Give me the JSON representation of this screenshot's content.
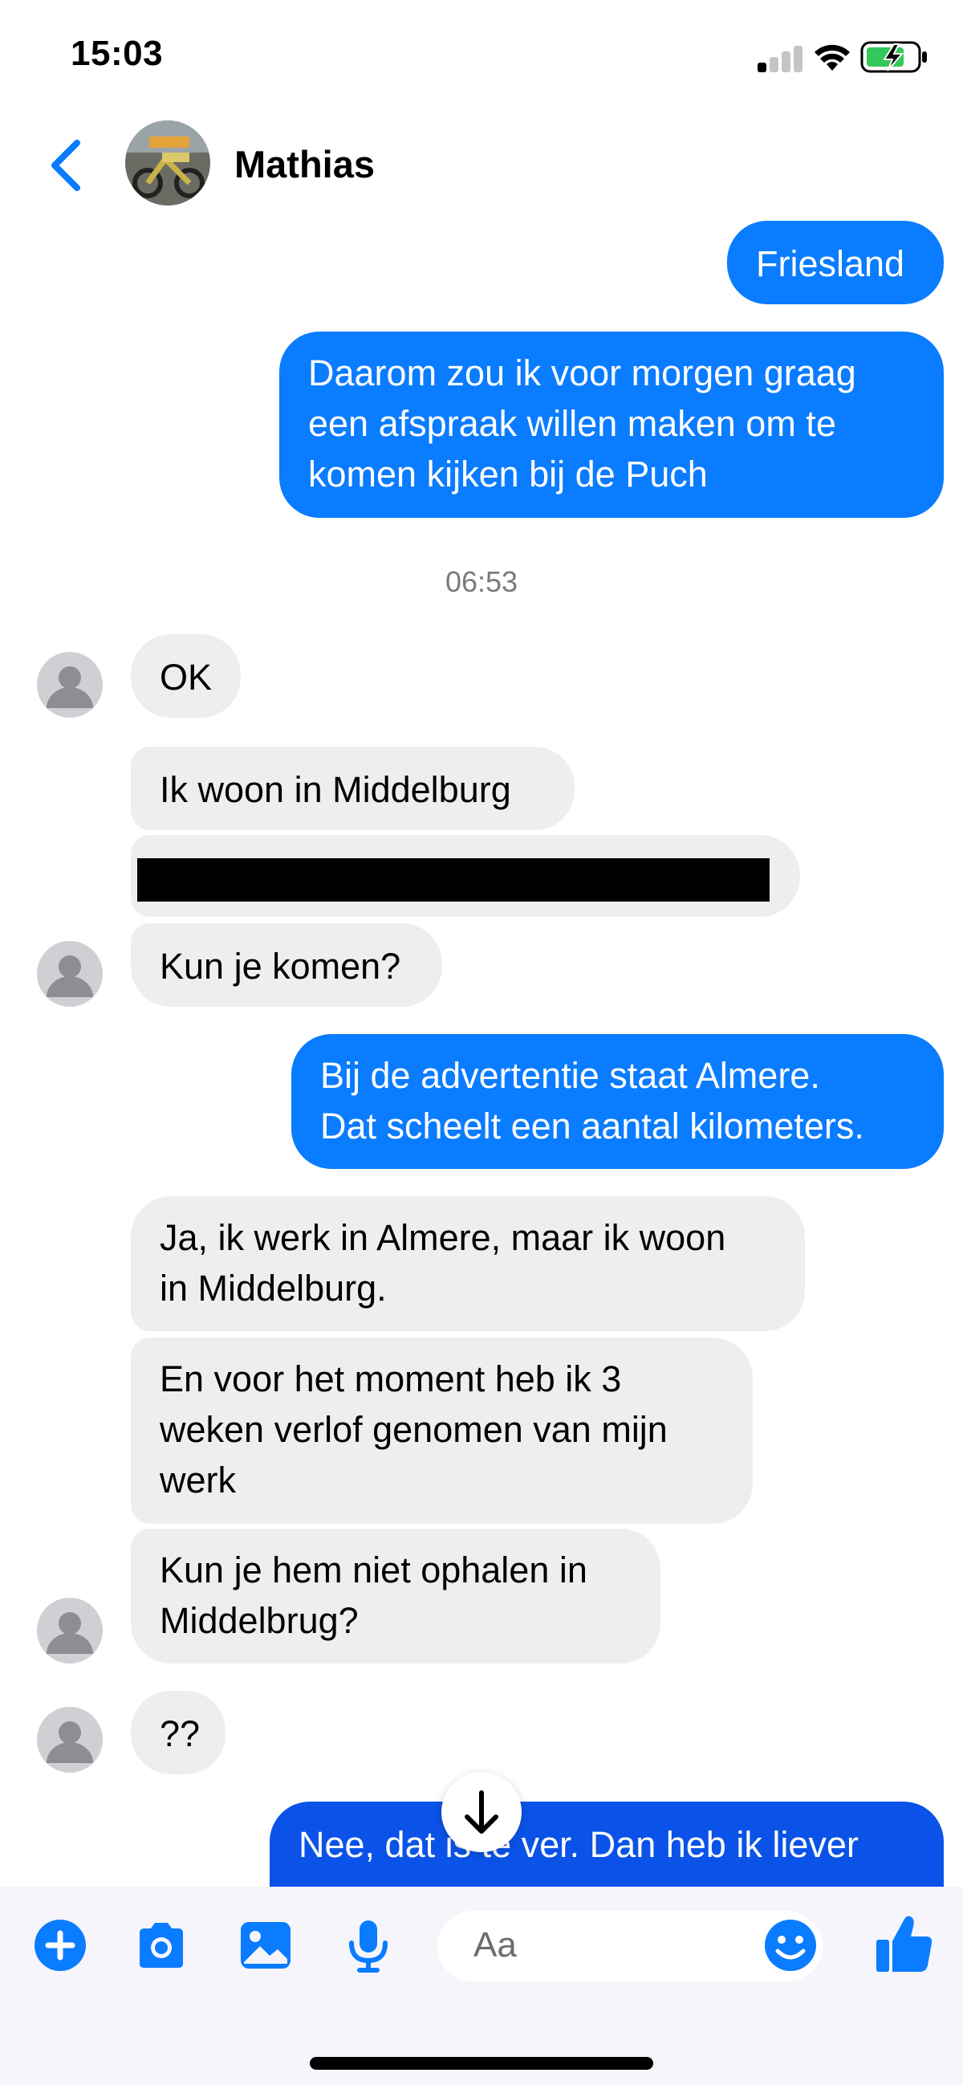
{
  "status_bar": {
    "time": "15:03",
    "icons": [
      "cellular-signal-icon",
      "wifi-icon",
      "battery-charging-icon"
    ]
  },
  "header": {
    "back_icon": "chevron-left-icon",
    "contact_name": "Mathias"
  },
  "conversation": {
    "outgoing_top": [
      "Friesland",
      "Daarom zou ik voor morgen graag\neen afspraak willen maken om te\nkomen kijken bij de Puch"
    ],
    "timestamp": "06:53",
    "incoming_1": "OK",
    "incoming_2": "Ik woon in Middelburg",
    "incoming_3_redacted": "",
    "incoming_4": "Kun je komen?",
    "outgoing_2": "Bij de advertentie staat Almere.\nDat scheelt een aantal kilometers.",
    "incoming_5": "Ja, ik werk in Almere, maar ik woon\nin Middelburg.",
    "incoming_6": "En voor het moment heb ik 3\nweken verlof genomen van mijn\nwerk",
    "incoming_7": "Kun je hem niet ophalen in\nMiddelbrug?",
    "incoming_8": "??",
    "outgoing_partial": "Nee, dat is te ver. Dan heb ik liever"
  },
  "composer": {
    "placeholder": "Aa",
    "tools": [
      "plus-icon",
      "camera-icon",
      "gallery-icon",
      "microphone-icon"
    ],
    "emoji_icon": "smiley-icon",
    "like_icon": "thumbs-up-icon"
  },
  "colors": {
    "accent": "#0a7cff",
    "outgoing_dark": "#0b53e8",
    "incoming_bubble": "#eeeef1",
    "timestamp": "#7a7a80"
  }
}
